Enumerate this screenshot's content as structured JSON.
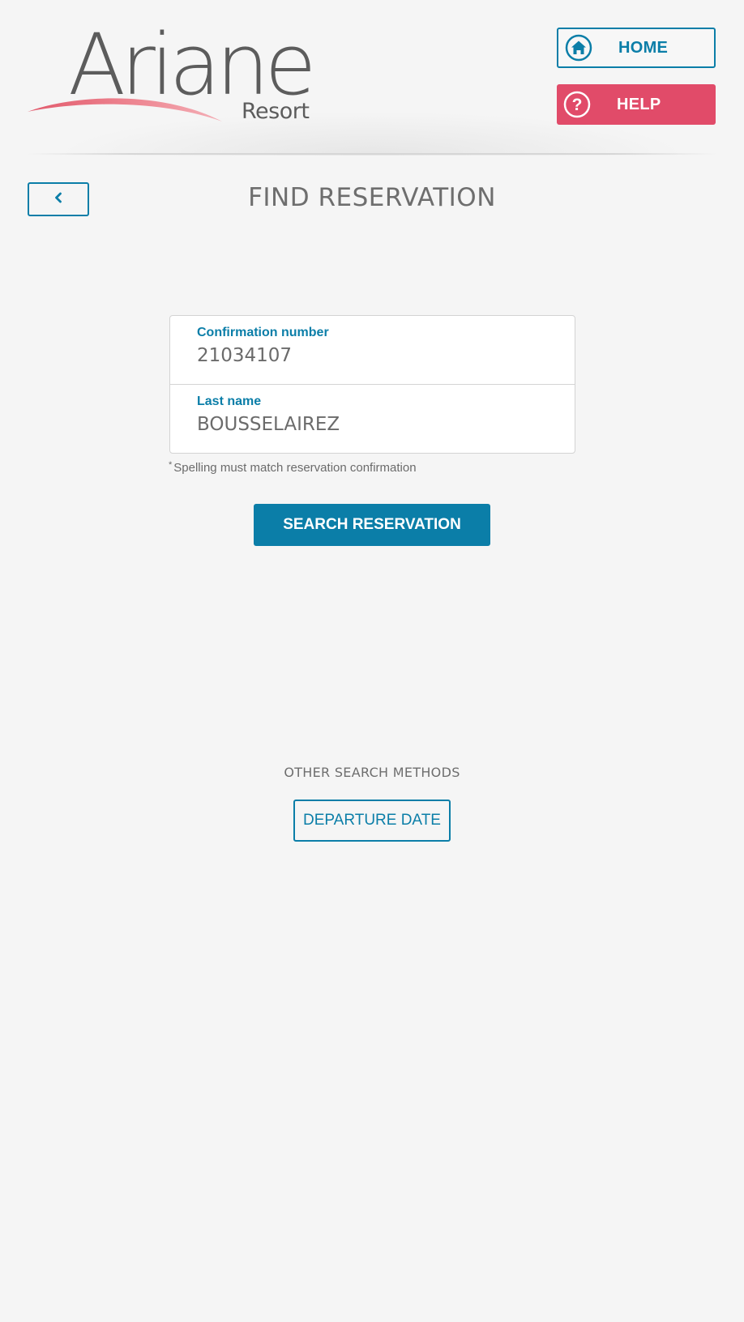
{
  "brand": {
    "logo_word": "Ariane",
    "logo_sub": "Resort"
  },
  "header": {
    "home_label": "HOME",
    "home_icon": "home-icon",
    "help_label": "HELP",
    "help_icon": "help-icon"
  },
  "page": {
    "title": "FIND RESERVATION",
    "back_icon": "chevron-left-icon"
  },
  "form": {
    "confirmation_label": "Confirmation number",
    "confirmation_value": "21034107",
    "last_name_label": "Last name",
    "last_name_value": "BOUSSELAIREZ",
    "note_marker": "*",
    "note_text": "Spelling must match reservation confirmation",
    "search_label": "SEARCH RESERVATION"
  },
  "other_methods": {
    "title": "OTHER SEARCH METHODS",
    "departure_label": "DEPARTURE DATE"
  },
  "colors": {
    "primary": "#0b7ea8",
    "help": "#e14b69",
    "background": "#f5f5f5",
    "text": "#6b6b6b",
    "swoosh": "#e8727f"
  }
}
